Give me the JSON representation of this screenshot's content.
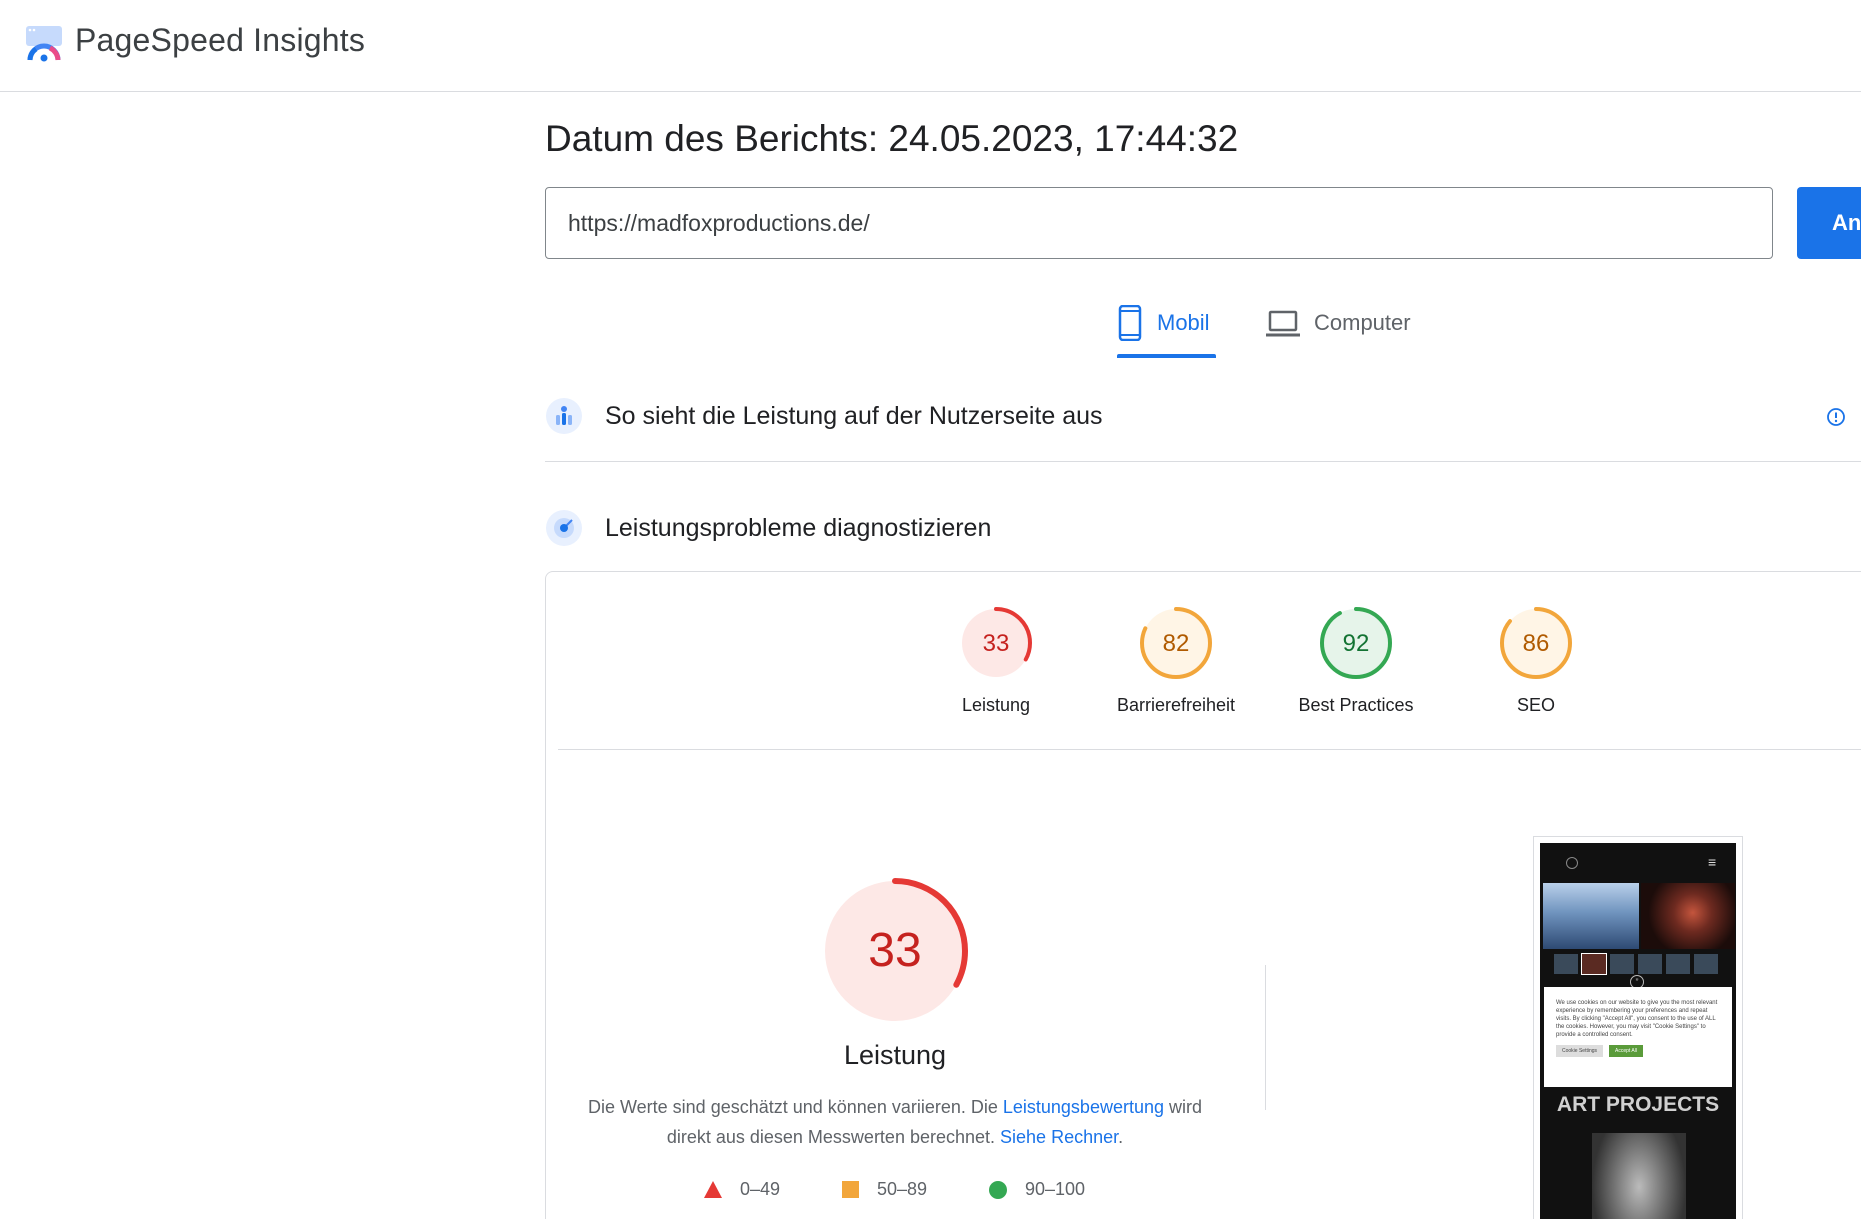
{
  "header": {
    "brand": "PageSpeed Insights",
    "logo_icon": "pagespeed-logo-icon"
  },
  "report": {
    "date_label": "Datum des Berichts: 24.05.2023, 17:44:32"
  },
  "search": {
    "url_value": "https://madfoxproductions.de/",
    "analyze_label": "An"
  },
  "tabs": {
    "mobile": {
      "label": "Mobil",
      "icon": "smartphone-icon",
      "active": true
    },
    "desktop": {
      "label": "Computer",
      "icon": "laptop-icon",
      "active": false
    }
  },
  "sections": {
    "field_data": {
      "title": "So sieht die Leistung auf der Nutzerseite aus",
      "icon": "users-chart-icon",
      "info_icon": "info-icon"
    },
    "diagnose": {
      "title": "Leistungsprobleme diagnostizieren",
      "icon": "lighthouse-icon"
    }
  },
  "scores": [
    {
      "label": "Leistung",
      "value": "33",
      "fraction": 0.33,
      "color": "#e53935",
      "bg": "#fde8e6",
      "text_color": "#c5221f"
    },
    {
      "label": "Barrierefreiheit",
      "value": "82",
      "fraction": 0.82,
      "color": "#f2a63b",
      "bg": "#fff5e6",
      "text_color": "#b05a00"
    },
    {
      "label": "Best Practices",
      "value": "92",
      "fraction": 0.92,
      "color": "#34a853",
      "bg": "#e6f4ea",
      "text_color": "#137333"
    },
    {
      "label": "SEO",
      "value": "86",
      "fraction": 0.86,
      "color": "#f2a63b",
      "bg": "#fff5e6",
      "text_color": "#b05a00"
    }
  ],
  "performance": {
    "value": "33",
    "fraction": 0.33,
    "title": "Leistung",
    "desc_part1": "Die Werte sind geschätzt und können variieren. Die ",
    "desc_link1": "Leistungsbewertung",
    "desc_part2": " wird direkt aus diesen Messwerten berechnet. ",
    "desc_link2": "Siehe Rechner",
    "desc_part3": "."
  },
  "legend": [
    {
      "range": "0–49",
      "shape": "triangle"
    },
    {
      "range": "50–89",
      "shape": "square"
    },
    {
      "range": "90–100",
      "shape": "circle"
    }
  ],
  "screenshot": {
    "cookie_text": "We use cookies on our website to give you the most relevant experience by remembering your preferences and repeat visits. By clicking \"Accept All\", you consent to the use of ALL the cookies. However, you may visit \"Cookie Settings\" to provide a controlled consent.",
    "cookie_settings": "Cookie Settings",
    "accept_all": "Accept All",
    "heading": "ART PROJECTS"
  }
}
